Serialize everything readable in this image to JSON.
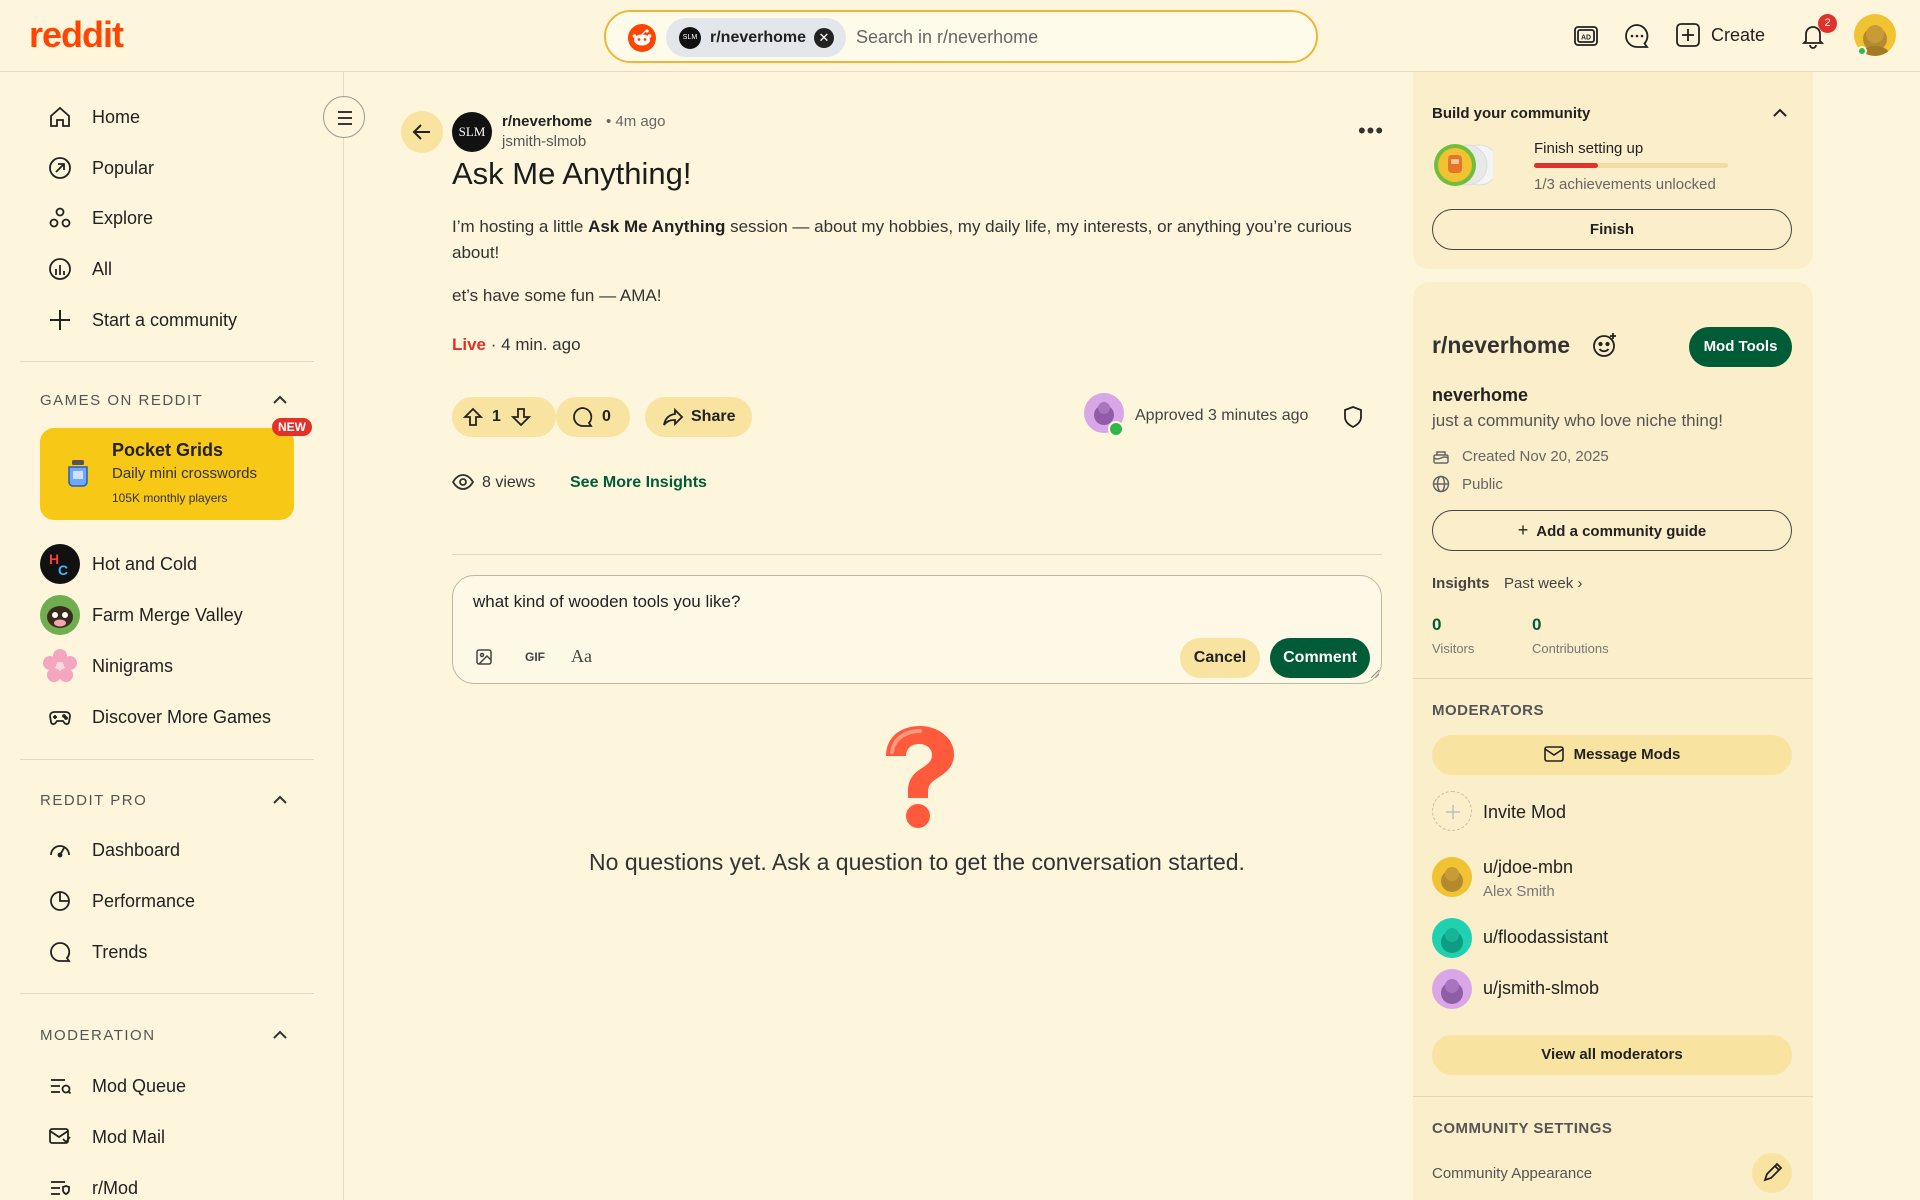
{
  "header": {
    "logo": "reddit",
    "search_chip": "r/neverhome",
    "search_chip_avatar": "SLM",
    "search_placeholder": "Search in r/neverhome",
    "create_label": "Create",
    "notification_count": "2",
    "colors": {
      "brand": "#ff4500",
      "accent_green": "#005c36",
      "live": "#e2312a"
    }
  },
  "sidebar": {
    "nav": [
      {
        "label": "Home",
        "icon": "home-icon"
      },
      {
        "label": "Popular",
        "icon": "popular-icon"
      },
      {
        "label": "Explore",
        "icon": "explore-icon"
      },
      {
        "label": "All",
        "icon": "all-icon"
      },
      {
        "label": "Start a community",
        "icon": "plus-icon"
      }
    ],
    "games_title": "GAMES ON REDDIT",
    "featured_game": {
      "title": "Pocket Grids",
      "subtitle": "Daily mini crosswords",
      "players": "105K monthly players",
      "badge": "NEW"
    },
    "games": [
      {
        "label": "Hot and Cold"
      },
      {
        "label": "Farm Merge Valley"
      },
      {
        "label": "Ninigrams"
      },
      {
        "label": "Discover More Games"
      }
    ],
    "pro_title": "REDDIT PRO",
    "pro": [
      {
        "label": "Dashboard"
      },
      {
        "label": "Performance"
      },
      {
        "label": "Trends"
      }
    ],
    "moderation_title": "MODERATION",
    "moderation": [
      {
        "label": "Mod Queue"
      },
      {
        "label": "Mod Mail"
      },
      {
        "label": "r/Mod"
      }
    ]
  },
  "post": {
    "avatar": "SLM",
    "subreddit": "r/neverhome",
    "time": "• 4m ago",
    "author": "jsmith-slmob",
    "title": "Ask Me Anything!",
    "body_pre": "I’m hosting a little ",
    "body_bold": "Ask Me Anything",
    "body_post": " session — about my hobbies, my daily life, my interests, or anything you’re curious about!",
    "body2": "et’s have some fun — AMA!",
    "live": "Live",
    "live_time": " · 4 min. ago",
    "votes": "1",
    "comments": "0",
    "share": "Share",
    "approved": "Approved 3 minutes ago",
    "views": "8 views",
    "insights_link": "See More Insights"
  },
  "comment_box": {
    "value": "what kind of wooden tools you like?",
    "gif": "GIF",
    "format": "Aa",
    "cancel": "Cancel",
    "submit": "Comment"
  },
  "empty_state": "No questions yet. Ask a question to get the conversation started.",
  "right": {
    "build_title": "Build your community",
    "finish_setting_up": "Finish setting up",
    "achievements": "1/3 achievements unlocked",
    "achievements_progress": 0.33,
    "finish_button": "Finish",
    "community_name": "r/neverhome",
    "mod_tools": "Mod Tools",
    "display_name": "neverhome",
    "description": "just a community who love niche thing!",
    "created": "Created Nov 20, 2025",
    "visibility": "Public",
    "guide_button": "Add a community guide",
    "insights_label": "Insights",
    "insights_period": "Past week",
    "visitors_n": "0",
    "visitors_l": "Visitors",
    "contrib_n": "0",
    "contrib_l": "Contributions",
    "moderators_title": "MODERATORS",
    "message_mods": "Message Mods",
    "invite_mod": "Invite Mod",
    "mods": [
      {
        "name": "u/jdoe-mbn",
        "sub": "Alex Smith",
        "color": "#f1c232"
      },
      {
        "name": "u/floodassistant",
        "color": "#1fd1b0"
      },
      {
        "name": "u/jsmith-slmob",
        "color": "#d9a6e8"
      }
    ],
    "view_all": "View all moderators",
    "settings_title": "COMMUNITY SETTINGS",
    "appearance": "Community Appearance"
  }
}
